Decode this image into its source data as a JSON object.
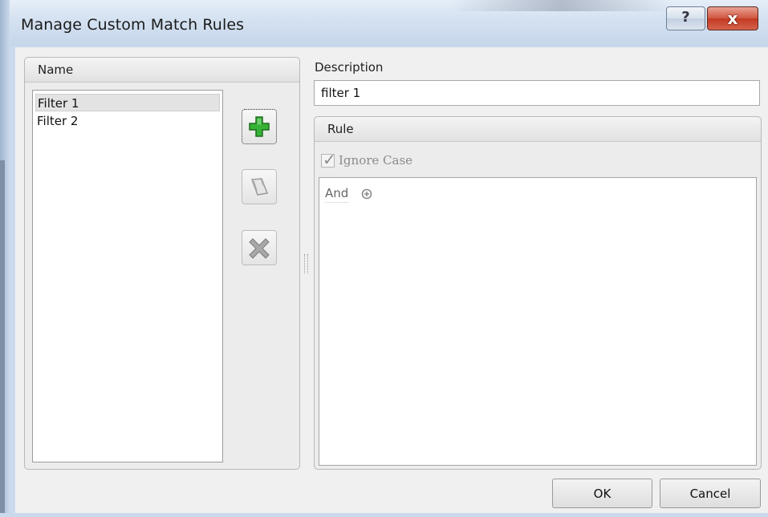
{
  "window": {
    "title": "Manage Custom Match Rules",
    "help_label": "?",
    "close_label": "x"
  },
  "name_panel": {
    "header": "Name",
    "items": [
      {
        "label": "Filter 1",
        "selected": true
      },
      {
        "label": "Filter 2",
        "selected": false
      }
    ]
  },
  "toolbar": {
    "add_icon": "add-plus-icon",
    "edit_icon": "edit-icon",
    "delete_icon": "delete-x-icon"
  },
  "description": {
    "label": "Description",
    "value": "filter 1"
  },
  "rule": {
    "header": "Rule",
    "ignore_case_label": "Ignore Case",
    "ignore_case_checked": true,
    "root_operator": "And",
    "add_condition_icon": "add-circle-icon"
  },
  "footer": {
    "ok_label": "OK",
    "cancel_label": "Cancel"
  },
  "colors": {
    "add_green": "#2ea02e",
    "frame_blue": "#cbd9ec",
    "close_red": "#c23a22"
  }
}
